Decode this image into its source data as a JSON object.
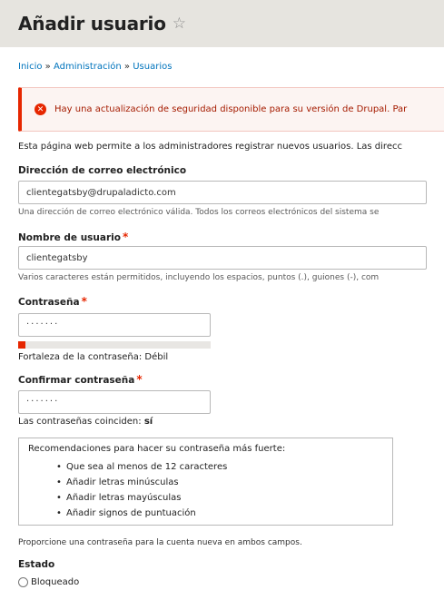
{
  "header": {
    "title": "Añadir usuario"
  },
  "breadcrumb": [
    {
      "label": "Inicio"
    },
    {
      "label": "Administración"
    },
    {
      "label": "Usuarios"
    }
  ],
  "breadcrumb_separator": "»",
  "alert": {
    "icon": "error-icon",
    "text": "Hay una actualización de seguridad disponible para su versión de Drupal. Par"
  },
  "intro": "Esta página web permite a los administradores registrar nuevos usuarios. Las direcc",
  "email": {
    "label": "Dirección de correo electrónico",
    "value": "clientegatsby@drupaladicto.com",
    "description": "Una dirección de correo electrónico válida. Todos los correos electrónicos del sistema se"
  },
  "username": {
    "label": "Nombre de usuario",
    "required_mark": "*",
    "value": "clientegatsby",
    "description": "Varios caracteres están permitidos, incluyendo los espacios, puntos (.), guiones (-), com"
  },
  "password": {
    "label": "Contraseña",
    "required_mark": "*",
    "masked_value": "·······",
    "strength_fraction": 0.04,
    "strength_text": "Fortaleza de la contraseña: Débil"
  },
  "confirm": {
    "label": "Confirmar contraseña",
    "required_mark": "*",
    "masked_value": "·······",
    "match_prefix": "Las contraseñas coinciden:",
    "match_value": "sí"
  },
  "recommendations": {
    "title": "Recomendaciones para hacer su contraseña más fuerte:",
    "items": [
      "Que sea al menos de 12 caracteres",
      "Añadir letras minúsculas",
      "Añadir letras mayúsculas",
      "Añadir signos de puntuación"
    ]
  },
  "password_hint": "Proporcione una contraseña para la cuenta nueva en ambos campos.",
  "status": {
    "label": "Estado",
    "option": "Bloqueado"
  },
  "colors": {
    "accent": "#0074bd",
    "error": "#e62600",
    "header_bg": "#e6e4df"
  }
}
